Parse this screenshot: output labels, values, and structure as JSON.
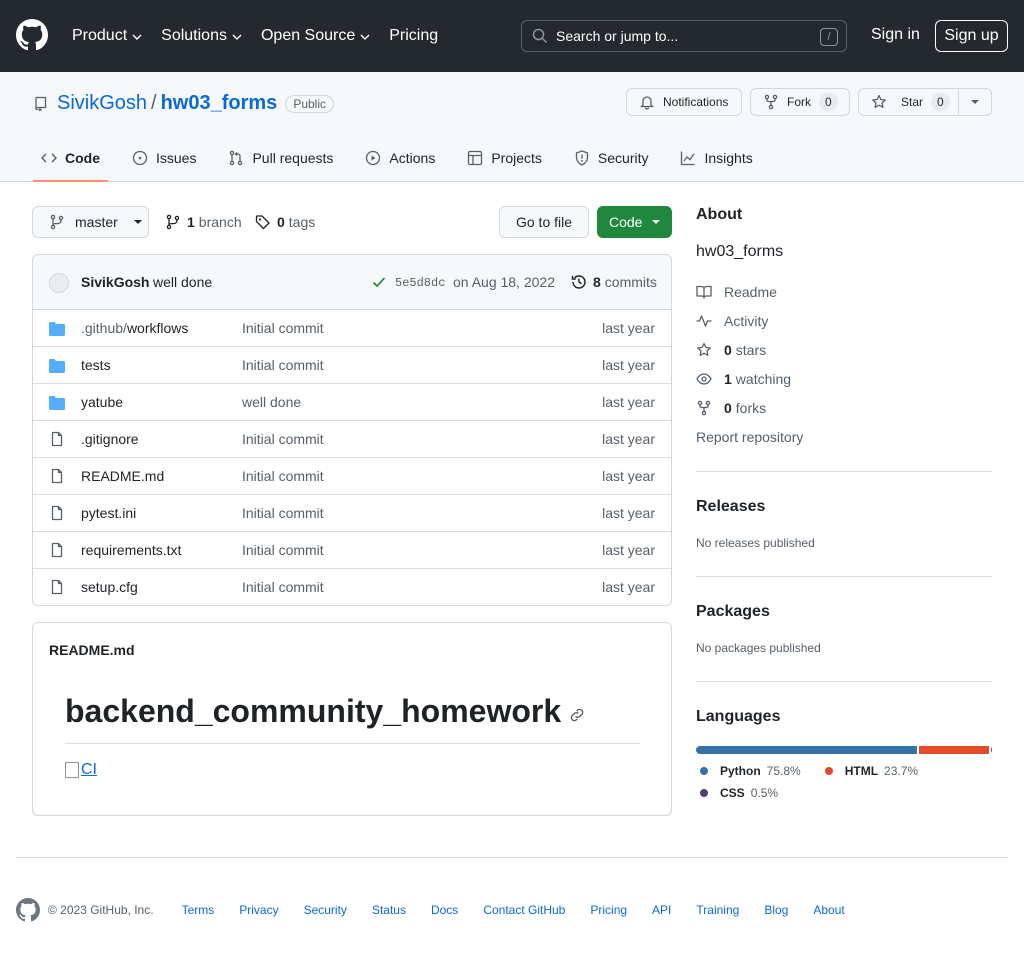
{
  "header": {
    "nav": [
      "Product",
      "Solutions",
      "Open Source",
      "Pricing"
    ],
    "search_placeholder": "Search or jump to...",
    "search_shortcut": "/",
    "signin": "Sign in",
    "signup": "Sign up"
  },
  "repo": {
    "owner": "SivikGosh",
    "separator": "/",
    "name": "hw03_forms",
    "visibility": "Public",
    "notifications_label": "Notifications",
    "fork_label": "Fork",
    "fork_count": "0",
    "star_label": "Star",
    "star_count": "0"
  },
  "tabs": [
    "Code",
    "Issues",
    "Pull requests",
    "Actions",
    "Projects",
    "Security",
    "Insights"
  ],
  "branch": {
    "name": "master",
    "branch_count": "1",
    "branch_label": "branch",
    "tag_count": "0",
    "tag_label": "tags",
    "goto_file": "Go to file",
    "code_label": "Code"
  },
  "commit": {
    "author": "SivikGosh",
    "message": "well done",
    "sha": "5e5d8dc",
    "date": "on Aug 18, 2022",
    "count": "8",
    "count_label": "commits"
  },
  "files": [
    {
      "prefix": ".github/",
      "name": "workflows",
      "type": "dir",
      "message": "Initial commit",
      "age": "last year"
    },
    {
      "prefix": "",
      "name": "tests",
      "type": "dir",
      "message": "Initial commit",
      "age": "last year"
    },
    {
      "prefix": "",
      "name": "yatube",
      "type": "dir",
      "message": "well done",
      "age": "last year"
    },
    {
      "prefix": "",
      "name": ".gitignore",
      "type": "file",
      "message": "Initial commit",
      "age": "last year"
    },
    {
      "prefix": "",
      "name": "README.md",
      "type": "file",
      "message": "Initial commit",
      "age": "last year"
    },
    {
      "prefix": "",
      "name": "pytest.ini",
      "type": "file",
      "message": "Initial commit",
      "age": "last year"
    },
    {
      "prefix": "",
      "name": "requirements.txt",
      "type": "file",
      "message": "Initial commit",
      "age": "last year"
    },
    {
      "prefix": "",
      "name": "setup.cfg",
      "type": "file",
      "message": "Initial commit",
      "age": "last year"
    }
  ],
  "readme": {
    "title": "README.md",
    "heading": "backend_community_homework",
    "badge_alt": "CI"
  },
  "about": {
    "title": "About",
    "description": "hw03_forms",
    "readme": "Readme",
    "activity": "Activity",
    "stars_count": "0",
    "stars_label": "stars",
    "watching_count": "1",
    "watching_label": "watching",
    "forks_count": "0",
    "forks_label": "forks",
    "report": "Report repository"
  },
  "releases": {
    "title": "Releases",
    "empty": "No releases published"
  },
  "packages": {
    "title": "Packages",
    "empty": "No packages published"
  },
  "languages": {
    "title": "Languages",
    "items": [
      {
        "name": "Python",
        "percent": "75.8%",
        "value": 75.8,
        "color": "#3572A5"
      },
      {
        "name": "HTML",
        "percent": "23.7%",
        "value": 23.7,
        "color": "#e34c26"
      },
      {
        "name": "CSS",
        "percent": "0.5%",
        "value": 0.5,
        "color": "#563d7c"
      }
    ]
  },
  "footer": {
    "copyright": "© 2023 GitHub, Inc.",
    "links": [
      "Terms",
      "Privacy",
      "Security",
      "Status",
      "Docs",
      "Contact GitHub",
      "Pricing",
      "API",
      "Training",
      "Blog",
      "About"
    ]
  }
}
